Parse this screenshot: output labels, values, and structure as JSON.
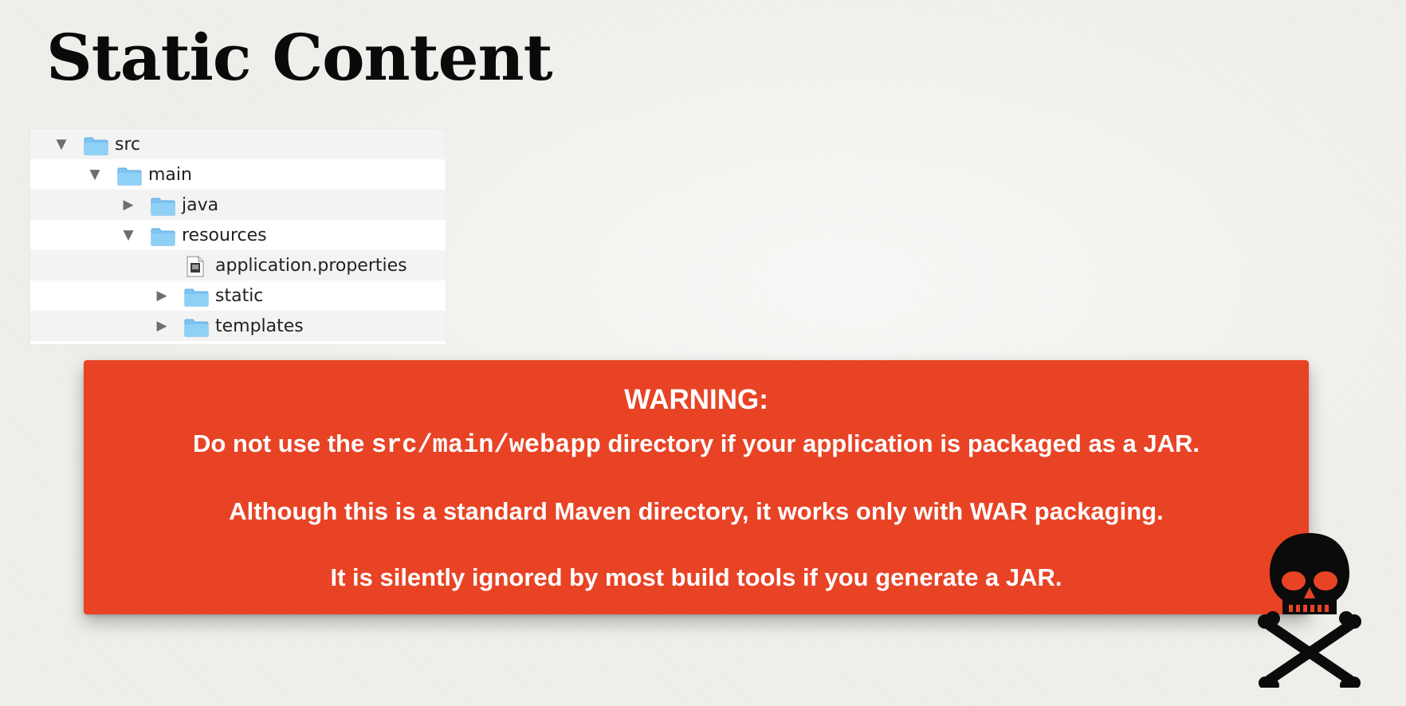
{
  "slide": {
    "title": "Static Content"
  },
  "file_tree": {
    "rows": [
      {
        "label": "src",
        "expanded": true,
        "type": "folder",
        "icon": "folder-icon"
      },
      {
        "label": "main",
        "expanded": true,
        "type": "folder",
        "icon": "folder-icon"
      },
      {
        "label": "java",
        "expanded": false,
        "type": "folder",
        "icon": "folder-icon"
      },
      {
        "label": "resources",
        "expanded": true,
        "type": "folder",
        "icon": "folder-icon"
      },
      {
        "label": "application.properties",
        "type": "file",
        "icon": "document-icon"
      },
      {
        "label": "static",
        "expanded": false,
        "type": "folder",
        "icon": "folder-icon"
      },
      {
        "label": "templates",
        "expanded": false,
        "type": "folder",
        "icon": "folder-icon"
      }
    ],
    "colors": {
      "folder": "#7ec4f2",
      "stripe": "#f3f3f3"
    }
  },
  "warning": {
    "title": "WARNING:",
    "line1_before": "Do not use the ",
    "line1_code": "src/main/webapp",
    "line1_after": " directory if your application is packaged as a JAR.",
    "line2": "Although this is a standard Maven directory, it works only with WAR packaging.",
    "line3": "It is silently ignored by most build tools if you generate a JAR.",
    "background_color": "#e84325",
    "text_color": "#ffffff"
  },
  "decoration": {
    "icon": "skull-crossbones-icon",
    "accent_color": "#e84325"
  }
}
